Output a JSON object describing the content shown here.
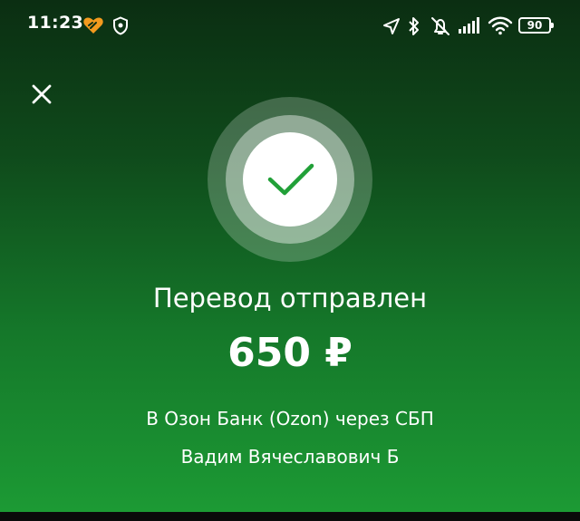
{
  "status_bar": {
    "time": "11:23",
    "battery_level": "90",
    "icons": [
      "heart-app-icon",
      "shield-icon",
      "location-icon",
      "bluetooth-icon",
      "alarm-off-icon",
      "signal-icon",
      "wifi-icon",
      "battery-icon"
    ]
  },
  "header": {
    "close_icon": "close-icon"
  },
  "status": {
    "icon": "check-icon",
    "title": "Перевод отправлен",
    "amount": "650 ₽"
  },
  "recipient": {
    "bank_line": "В Озон Банк (Ozon) через СБП",
    "name": "Вадим Вячеславович Б"
  },
  "colors": {
    "accent_green": "#21A038",
    "background_top": "#0b2e12",
    "background_bottom": "#1c9a34"
  }
}
